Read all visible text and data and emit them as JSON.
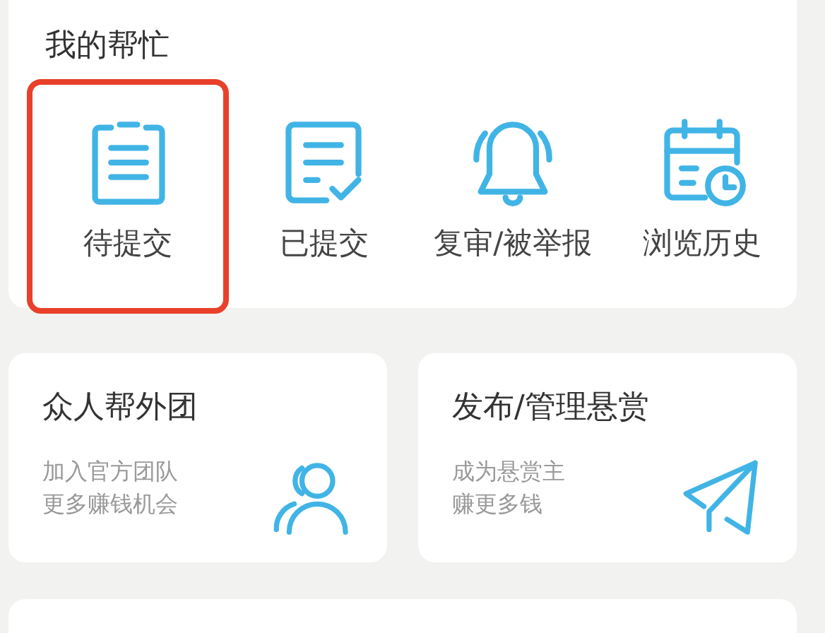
{
  "my_help": {
    "title": "我的帮忙",
    "items": [
      {
        "label": "待提交",
        "kind": "clipboard",
        "selected": true
      },
      {
        "label": "已提交",
        "kind": "checked-doc",
        "selected": false
      },
      {
        "label": "复审/被举报",
        "kind": "bell",
        "selected": false
      },
      {
        "label": "浏览历史",
        "kind": "calendar",
        "selected": false
      }
    ]
  },
  "cards": [
    {
      "title": "众人帮外团",
      "lines": [
        "加入官方团队",
        "更多赚钱机会"
      ],
      "kind": "people"
    },
    {
      "title": "发布/管理悬赏",
      "lines": [
        "成为悬赏主",
        "赚更多钱"
      ],
      "kind": "plane"
    }
  ]
}
